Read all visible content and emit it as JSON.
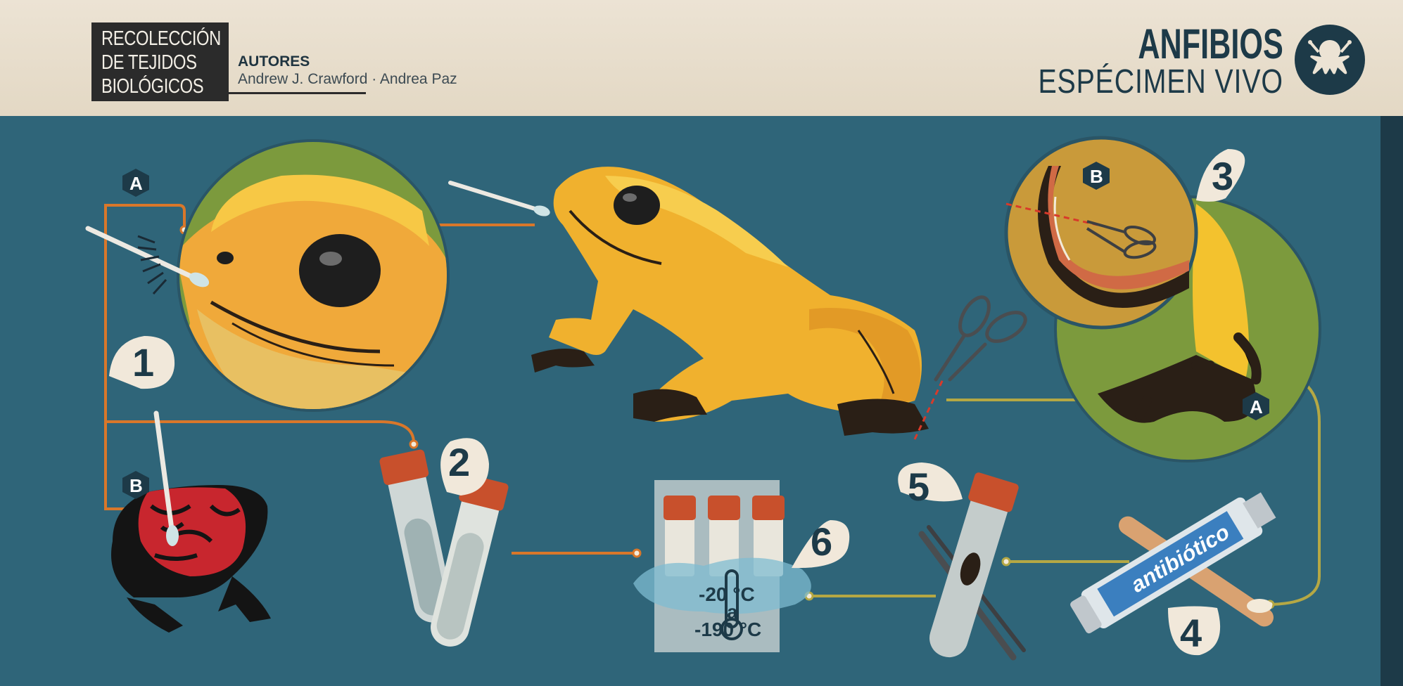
{
  "header": {
    "title_lines": [
      "RECOLECCIÓN",
      "DE TEJIDOS",
      "BIOLÓGICOS"
    ],
    "authors_label": "AUTORES",
    "authors_names": "Andrew J. Crawford · Andrea Paz",
    "group_title": "ANFIBIOS",
    "group_subtitle": "ESPÉCIMEN VIVO",
    "badge_icon": "frog-icon"
  },
  "steps": [
    "1",
    "2",
    "3",
    "4",
    "5",
    "6"
  ],
  "markers": {
    "a": "A",
    "b": "B"
  },
  "storage": {
    "temp_high": "-20 °C",
    "temp_joiner": "a",
    "temp_low": "-190 °C"
  },
  "ointment_label": "antibiótico",
  "colors": {
    "background": "#2f6579",
    "header": "#e6dccb",
    "navy": "#1d3a48",
    "swab_line": "#d9772a",
    "tissue_line": "#b5a844",
    "golden_frog": "#f0b12e",
    "poison_frog_red": "#c8262e",
    "tube_cap": "#c8502c",
    "zoom_circle": "#7c9a3d"
  }
}
